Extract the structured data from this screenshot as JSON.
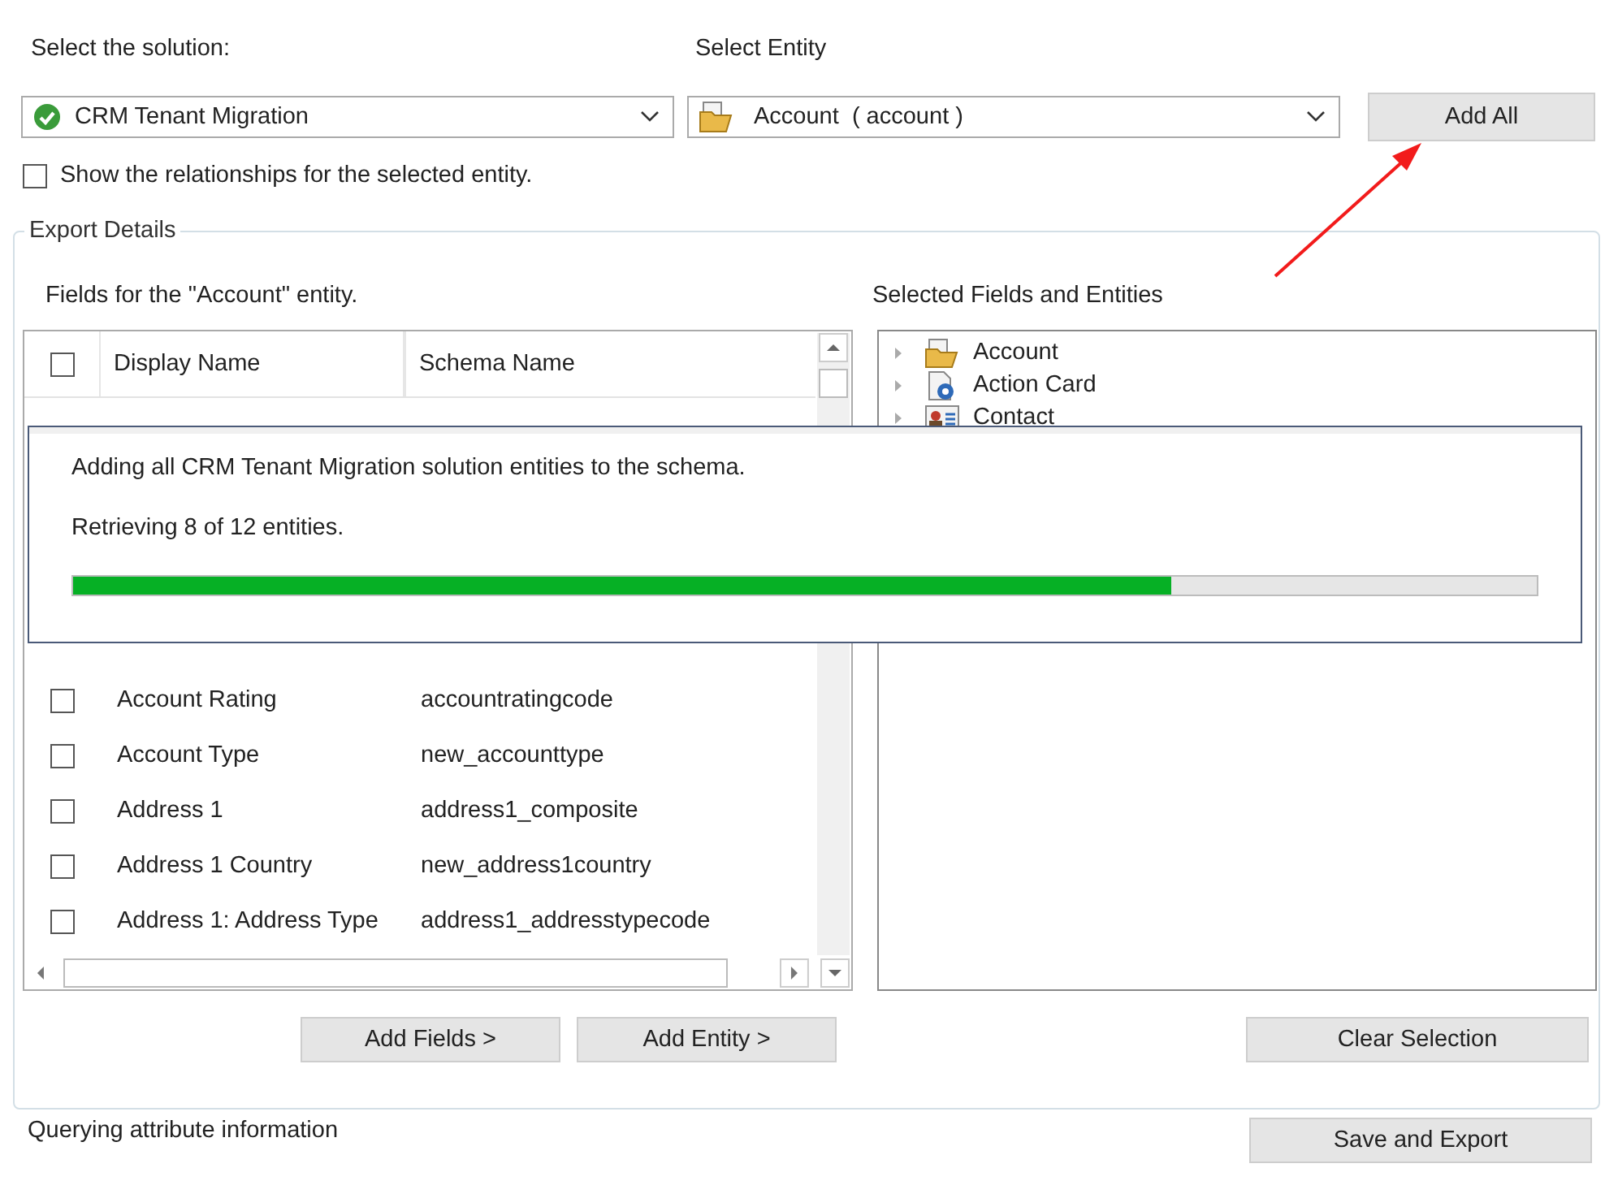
{
  "solution": {
    "label": "Select the solution:",
    "value": "CRM Tenant Migration"
  },
  "entity": {
    "label": "Select Entity",
    "value": "Account  ( account )"
  },
  "add_all_button": "Add All",
  "show_relationships": {
    "label": "Show the relationships for the selected entity.",
    "checked": false
  },
  "export_details": {
    "legend": "Export Details",
    "fields_label": "Fields  for the \"Account\" entity.",
    "table": {
      "columns": [
        "Display Name",
        "Schema Name"
      ],
      "header_checked": false,
      "rows": [
        {
          "display_name": "Account Rating",
          "schema_name": "accountratingcode",
          "checked": false
        },
        {
          "display_name": "Account Type",
          "schema_name": "new_accounttype",
          "checked": false
        },
        {
          "display_name": "Address 1",
          "schema_name": "address1_composite",
          "checked": false
        },
        {
          "display_name": "Address 1 Country",
          "schema_name": "new_address1country",
          "checked": false
        },
        {
          "display_name": "Address 1: Address Type",
          "schema_name": "address1_addresstypecode",
          "checked": false
        }
      ]
    },
    "selected_label": "Selected Fields and Entities",
    "tree": [
      {
        "label": "Account",
        "expanded": false
      },
      {
        "label": "Action Card",
        "expanded": false
      },
      {
        "label": "Contact",
        "expanded": false
      }
    ],
    "buttons": [
      "Add Fields >",
      "Add Entity >"
    ],
    "clear_button": "Clear Selection"
  },
  "progress_dialog": {
    "message": "Adding all CRM Tenant Migration solution entities to the schema.",
    "status": "Retrieving 8 of 12 entities.",
    "level": 0.75
  },
  "status_text": "Querying attribute information",
  "save_button": "Save and Export"
}
